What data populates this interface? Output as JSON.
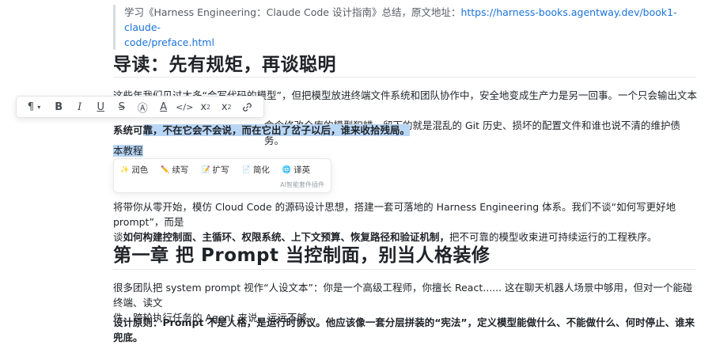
{
  "quote": {
    "prefix": "学习《Harness Engineering：Claude Code 设计指南》总结，原文地址：",
    "link_line1": "https://harness-books.agentway.dev/book1-claude-",
    "link_line2": "code/preface.html"
  },
  "heading1": "导读：先有规矩，再谈聪明",
  "para1": {
    "line1": "这些年我们见过太多“会写代码的模型”，但把模型放进终端文件系统和团队协作中，安全地变成生产力是另一回事。一个只会输出文本的模型犯",
    "line2": "命令修改仓库的模型犯错，留下的就是混乱的 Git 历史、损坏的配置文件和谁也说不清的维护债务。"
  },
  "para2": {
    "plain": "系统可",
    "selected": "靠，不在它会不会说，而在它出了岔子以后，谁来收拾残局。"
  },
  "para3": "本教程",
  "toolbar": {
    "items": [
      {
        "label": "¶ ▾",
        "name": "paragraph-style-button"
      },
      {
        "label": "B",
        "name": "bold-button"
      },
      {
        "label": "I",
        "name": "italic-button"
      },
      {
        "label": "U",
        "name": "underline-button"
      },
      {
        "label": "S",
        "name": "strikethrough-button"
      },
      {
        "label": "Ⓐ",
        "name": "highlight-button"
      },
      {
        "label": "A",
        "name": "font-color-button"
      },
      {
        "label": "</>",
        "name": "inline-code-button"
      },
      {
        "label": "x²",
        "name": "superscript-button"
      },
      {
        "label": "x₂",
        "name": "subscript-button"
      },
      {
        "label": "🔗",
        "name": "link-button"
      }
    ]
  },
  "ai_popup": {
    "buttons": [
      {
        "icon": "✨",
        "label": "润色"
      },
      {
        "icon": "✏️",
        "label": "续写"
      },
      {
        "icon": "📝",
        "label": "扩写"
      },
      {
        "icon": "📄",
        "label": "简化"
      },
      {
        "icon": "🌐",
        "label": "译英"
      }
    ],
    "footer": "AI智能套件插件"
  },
  "para4": {
    "line1": "将带你从零开始，模仿 Cloud Code 的源码设计思想，搭建一套可落地的 Harness Engineering 体系。我们不谈“如何写更好地 prompt”，而是",
    "line2_prefix": "谈",
    "line2_bold": "如何构建控制面、主循环、权限系统、上下文预算、恢复路径和验证机制，",
    "line2_suffix": "把不可靠的模型收束进可持续运行的工程秩序。"
  },
  "heading2": "第一章 把 Prompt 当控制面，别当人格装修",
  "para5": {
    "line1": "很多团队把 system prompt 视作“人设文本”：你是一个高级工程师，你擅长 React...... 这在聊天机器人场景中够用，但对一个能碰终端、读文",
    "line2": "件、跨轮执行任务的 Agent 来说，远远不够。"
  },
  "para6": "设计原则：Prompt 不是人格，是运行时协议。他应该像一套分层拼装的“宪法”，定义模型能做什么、不能做什么、何时停止、谁来兜底。"
}
